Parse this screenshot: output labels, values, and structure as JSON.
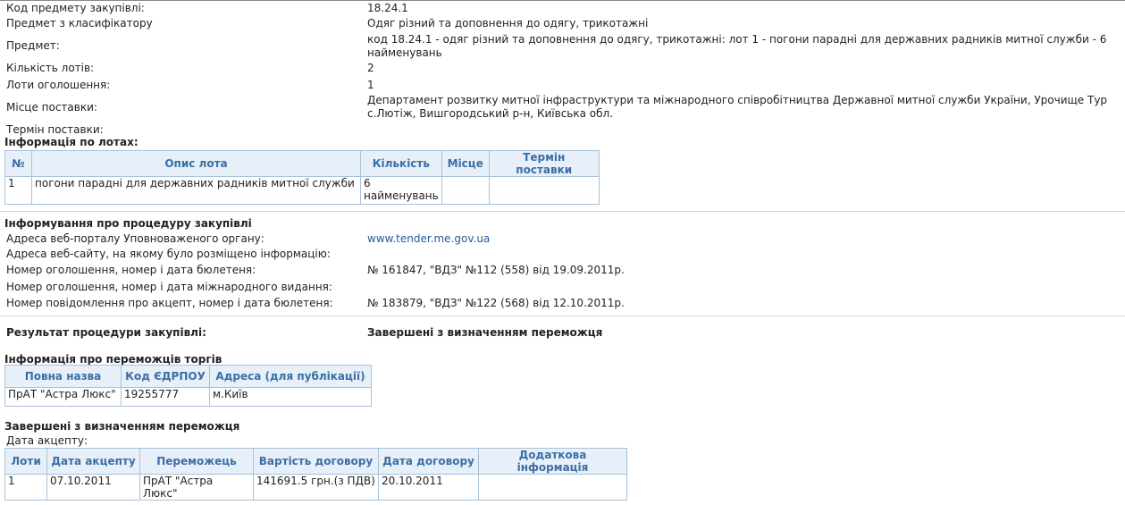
{
  "info": {
    "rows": [
      {
        "label": "Код предмету закупівлі:",
        "value": "18.24.1"
      },
      {
        "label": "Предмет з класифікатору",
        "value": "Одяг різний та доповнення до одягу, трикотажні"
      },
      {
        "label": "Предмет:",
        "value_lines": [
          "код 18.24.1 - одяг різний та доповнення до одягу, трикотажні: лот 1 - погони парадні для державних радників митної служби - 6",
          "найменувань"
        ]
      },
      {
        "label": "Кількість лотів:",
        "value": "2"
      },
      {
        "label": "Лоти оголошення:",
        "value": "1"
      },
      {
        "label": "Місце поставки:",
        "value_lines": [
          "Департамент розвитку митної інфраструктури та міжнародного співробітництва Державної митної служби України, Урочище Тур",
          "с.Лютіж, Вишгородський р-н, Київська обл."
        ]
      },
      {
        "label": "Термін поставки:",
        "value": ""
      }
    ]
  },
  "lots": {
    "heading": "Інформація по лотах:",
    "headers": [
      "№",
      "Опис лота",
      "Кількість",
      "Місце",
      "Термін поставки"
    ],
    "row": {
      "num": "1",
      "desc": "погони парадні для державних радників митної служби",
      "qty_lines": [
        "6",
        "найменувань"
      ],
      "place": "",
      "term": ""
    }
  },
  "procedure": {
    "heading": "Інформування про процедуру закупівлі",
    "rows": [
      {
        "label": "Адреса веб-порталу Уповноваженого органу:",
        "value": "www.tender.me.gov.ua"
      },
      {
        "label": "Адреса веб-сайту, на якому було розміщено інформацію:",
        "value": ""
      },
      {
        "label": "Номер оголошення, номер і дата бюлетеня:",
        "value": "№ 161847, \"ВДЗ\" №112 (558) від 19.09.2011р."
      },
      {
        "label": "Номер оголошення, номер і дата міжнародного видання:",
        "value": ""
      },
      {
        "label": "Номер повідомлення про акцепт, номер і дата бюлетеня:",
        "value": "№ 183879, \"ВДЗ\" №122 (568) від 12.10.2011р."
      }
    ]
  },
  "result": {
    "label": "Результат процедури закупівлі:",
    "value": "Завершені з визначенням переможця"
  },
  "winners": {
    "heading": "Інформація про переможців торгів",
    "headers": [
      "Повна назва",
      "Код ЄДРПОУ",
      "Адреса (для публікації)"
    ],
    "row": [
      "ПрАТ \"Астра Люкс\"",
      "19255777",
      "м.Київ"
    ]
  },
  "completed": {
    "heading": "Завершені з визначенням переможця",
    "accept_label": "Дата акцепту:",
    "headers": [
      "Лоти",
      "Дата акцепту",
      "Переможець",
      "Вартість договору",
      "Дата договору",
      "Додаткова інформація"
    ],
    "row": [
      "1",
      "07.10.2011",
      "ПрАТ \"Астра Люкс\"",
      "141691.5 грн.(з ПДВ)",
      "20.10.2011",
      ""
    ]
  }
}
